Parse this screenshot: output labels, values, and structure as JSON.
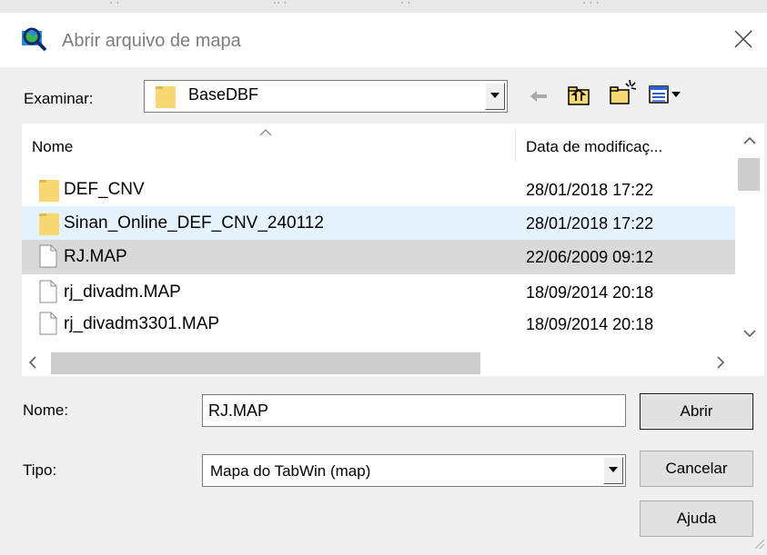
{
  "dialog": {
    "title": "Abrir arquivo de mapa",
    "look_in_label": "Examinar:",
    "look_in_value": "BaseDBF",
    "toolbar_icons": [
      "back-arrow-icon",
      "up-folder-icon",
      "new-folder-icon",
      "view-menu-icon"
    ]
  },
  "file_list": {
    "columns": [
      "Nome",
      "Data de modificaç..."
    ],
    "rows": [
      {
        "name": "DEF_CNV",
        "date": "28/01/2018 17:22",
        "type": "folder"
      },
      {
        "name": "Sinan_Online_DEF_CNV_240112",
        "date": "28/01/2018 17:22",
        "type": "folder"
      },
      {
        "name": "RJ.MAP",
        "date": "22/06/2009 09:12",
        "type": "file"
      },
      {
        "name": "rj_divadm.MAP",
        "date": "18/09/2014 20:18",
        "type": "file"
      },
      {
        "name": "rj_divadm3301.MAP",
        "date": "18/09/2014 20:18",
        "type": "file"
      }
    ],
    "selected_row": "RJ.MAP",
    "hovered_row": "Sinan_Online_DEF_CNV_240112"
  },
  "form": {
    "name_label": "Nome:",
    "name_value": "RJ.MAP",
    "type_label": "Tipo:",
    "type_value": "Mapa do TabWin (map)"
  },
  "buttons": {
    "open": "Abrir",
    "cancel": "Cancelar",
    "help": "Ajuda"
  },
  "colors": {
    "selected_row": "#d9d9d9",
    "hover_row": "#e5f3ff",
    "folder": "#f8d775",
    "window_bg": "#f0f0f0"
  }
}
